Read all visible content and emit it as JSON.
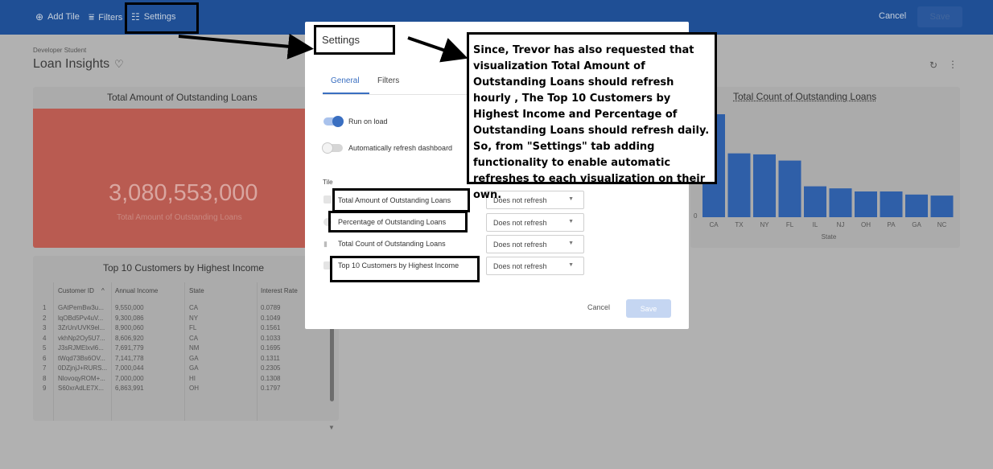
{
  "topbar": {
    "add_tile": "Add Tile",
    "filters": "Filters",
    "settings": "Settings",
    "cancel": "Cancel",
    "save": "Save",
    "colors": {
      "bar": "#1f4f95"
    }
  },
  "dashboard": {
    "folder": "Developer Student",
    "title": "Loan Insights"
  },
  "tiles": {
    "amount": {
      "title": "Total Amount of Outstanding Loans",
      "value": "3,080,553,000",
      "subtitle": "Total Amount of Outstanding Loans"
    },
    "count": {
      "title": "Total Count of Outstanding Loans",
      "xlabel": "State",
      "tick_top": "0",
      "tick_bottom": "0"
    },
    "top10": {
      "title": "Top 10 Customers by Highest Income",
      "columns": [
        "Customer ID",
        "Annual Income",
        "State",
        "Interest Rate"
      ],
      "rows": [
        {
          "idx": "1",
          "id": "GAtPemBw3u...",
          "income": "9,550,000",
          "state": "CA",
          "rate": "0.0789"
        },
        {
          "idx": "2",
          "id": "lqOBd5Pv4uV...",
          "income": "9,300,086",
          "state": "NY",
          "rate": "0.1049"
        },
        {
          "idx": "3",
          "id": "3ZrUn/UVK9el...",
          "income": "8,900,060",
          "state": "FL",
          "rate": "0.1561"
        },
        {
          "idx": "4",
          "id": "vkhNp2Oy5U7...",
          "income": "8,606,920",
          "state": "CA",
          "rate": "0.1033"
        },
        {
          "idx": "5",
          "id": "J3sRJMElxvl6...",
          "income": "7,691,779",
          "state": "NM",
          "rate": "0.1695"
        },
        {
          "idx": "6",
          "id": "tWqd73Bs6OV...",
          "income": "7,141,778",
          "state": "GA",
          "rate": "0.1311"
        },
        {
          "idx": "7",
          "id": "0DZjnjJ+RURS...",
          "income": "7,000,044",
          "state": "GA",
          "rate": "0.2305"
        },
        {
          "idx": "8",
          "id": "NlovoqyROM+...",
          "income": "7,000,000",
          "state": "HI",
          "rate": "0.1308"
        },
        {
          "idx": "9",
          "id": "S60xrAdLE7X...",
          "income": "6,863,991",
          "state": "OH",
          "rate": "0.1797"
        }
      ]
    }
  },
  "chart_data": {
    "type": "bar",
    "title": "Total Count of Outstanding Loans",
    "xlabel": "State",
    "categories": [
      "CA",
      "TX",
      "NY",
      "FL",
      "IL",
      "NJ",
      "OH",
      "PA",
      "GA",
      "NC"
    ],
    "values": [
      100,
      62,
      61,
      55,
      30,
      28,
      25,
      25,
      22,
      21
    ],
    "color": "#2f5fa8"
  },
  "modal": {
    "title": "Settings",
    "tabs": [
      "General",
      "Filters"
    ],
    "run_on_load": "Run on load",
    "auto_refresh": "Automatically refresh dashboard",
    "tile_header": "Tile",
    "tile_rows": [
      {
        "label": "Total Amount of Outstanding Loans",
        "refresh": "Does not refresh"
      },
      {
        "label": "Percentage of Outstanding Loans",
        "refresh": "Does not refresh"
      },
      {
        "label": "Total Count of Outstanding Loans",
        "refresh": "Does not refresh"
      },
      {
        "label": "Top 10 Customers by Highest Income",
        "refresh": "Does not refresh"
      }
    ],
    "cancel": "Cancel",
    "save": "Save",
    "accent": "#3a6fc1"
  },
  "annotation": {
    "note": "Since, Trevor has also requested that visualization Total Amount of Outstanding Loans should refresh hourly , The Top 10 Customers by Highest Income and Percentage of Outstanding Loans should refresh daily. So, from \"Settings\" tab adding functionality to enable automatic refreshes to each visualization on their own."
  }
}
